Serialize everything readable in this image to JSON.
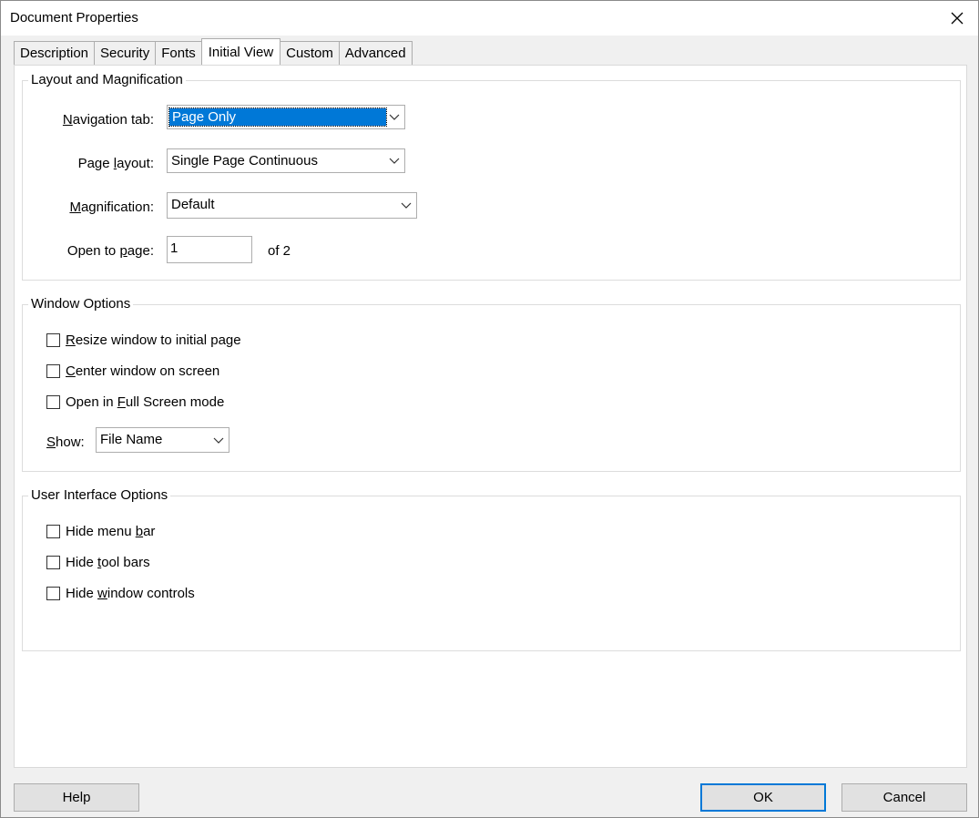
{
  "window": {
    "title": "Document Properties"
  },
  "tabs": [
    {
      "label": "Description"
    },
    {
      "label": "Security"
    },
    {
      "label": "Fonts"
    },
    {
      "label": "Initial View",
      "active": true
    },
    {
      "label": "Custom"
    },
    {
      "label": "Advanced"
    }
  ],
  "layout_group": {
    "title": "Layout and Magnification",
    "navigation_tab": {
      "label_pre": "",
      "label_key": "N",
      "label_post": "avigation tab:",
      "value": "Page Only"
    },
    "page_layout": {
      "label_pre": "Page ",
      "label_key": "l",
      "label_post": "ayout:",
      "value": "Single Page Continuous"
    },
    "magnification": {
      "label_pre": "",
      "label_key": "M",
      "label_post": "agnification:",
      "value": "Default"
    },
    "open_to_page": {
      "label_pre": "Open to ",
      "label_key": "p",
      "label_post": "age:",
      "value": "1",
      "suffix": "of 2"
    }
  },
  "window_group": {
    "title": "Window Options",
    "options": [
      {
        "pre": "",
        "key": "R",
        "post": "esize window to initial page",
        "checked": false
      },
      {
        "pre": "",
        "key": "C",
        "post": "enter window on screen",
        "checked": false
      },
      {
        "pre": "Open in ",
        "key": "F",
        "post": "ull Screen mode",
        "checked": false
      }
    ],
    "show": {
      "label_pre": "",
      "label_key": "S",
      "label_post": "how:",
      "value": "File Name"
    }
  },
  "ui_group": {
    "title": "User Interface Options",
    "options": [
      {
        "pre": "Hide menu ",
        "key": "b",
        "post": "ar",
        "checked": false
      },
      {
        "pre": "Hide ",
        "key": "t",
        "post": "ool bars",
        "checked": false
      },
      {
        "pre": "Hide ",
        "key": "w",
        "post": "indow controls",
        "checked": false
      }
    ]
  },
  "buttons": {
    "help": "Help",
    "ok": "OK",
    "cancel": "Cancel"
  },
  "colors": {
    "accent": "#0078d7",
    "dialog_bg": "#f0f0f0",
    "panel_bg": "#ffffff"
  },
  "icons": {
    "close": "close-icon",
    "dropdown": "chevron-down-icon"
  }
}
